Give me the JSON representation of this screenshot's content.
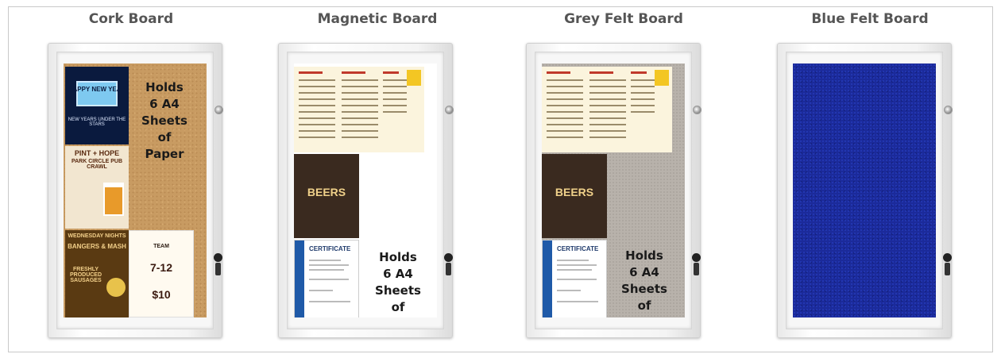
{
  "boards": [
    {
      "title": "Cork Board",
      "holds_lines": [
        "Holds",
        "6 A4",
        "Sheets",
        "of Paper"
      ]
    },
    {
      "title": "Magnetic Board",
      "holds_lines": [
        "Holds",
        "6 A4",
        "Sheets",
        "of Paper"
      ]
    },
    {
      "title": "Grey Felt Board",
      "holds_lines": [
        "Holds",
        "6 A4",
        "Sheets",
        "of Paper"
      ]
    },
    {
      "title": "Blue Felt Board"
    }
  ],
  "posters": {
    "beers_title": "BEERS",
    "certificate_title": "CERTIFICATE",
    "nye_sign": "HAPPY NEW YEAR",
    "nye_caption": "NEW YEARS UNDER THE STARS",
    "pub_title": "PINT + HOPE",
    "pub_sub": "PARK CIRCLE PUB CRAWL",
    "sausage_title": "WEDNESDAY NIGHTS",
    "sausage_sub": "BANGERS & MASH",
    "sausage_body": "FRESHLY PRODUCED SAUSAGES",
    "team_title": "TEAM",
    "team_date": "7-12",
    "team_price": "$10"
  },
  "colors": {
    "cork": "#c89b62",
    "magnetic": "#ffffff",
    "grey_felt": "#b8b2ab",
    "blue_felt": "#1b2a9a"
  }
}
